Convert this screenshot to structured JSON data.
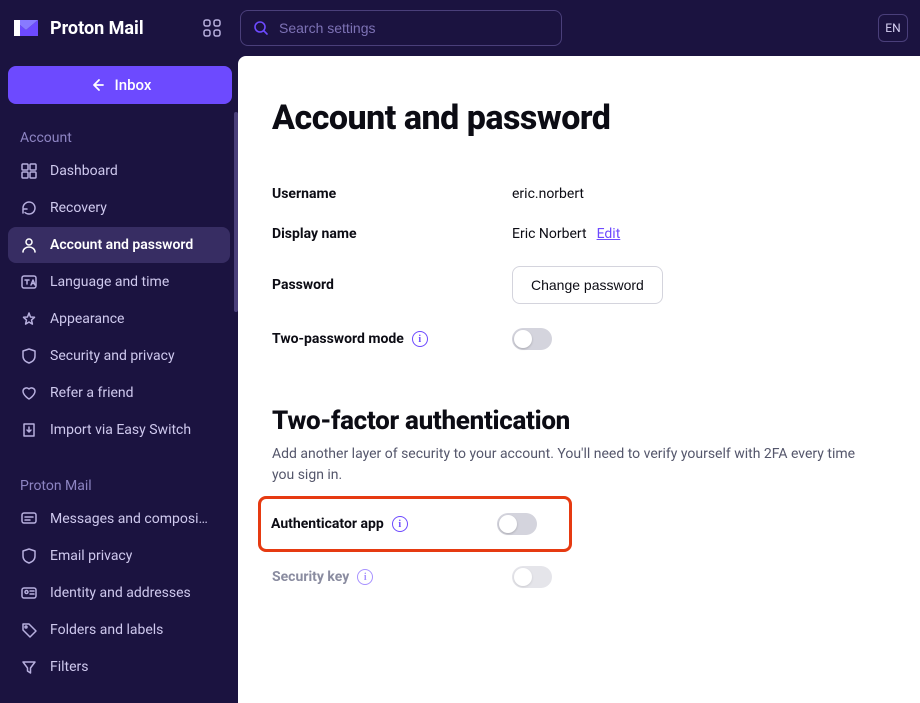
{
  "brand": {
    "name": "Proton Mail"
  },
  "search": {
    "placeholder": "Search settings"
  },
  "lang": "EN",
  "inboxButton": "Inbox",
  "sectionAccount": "Account",
  "sectionProtonMail": "Proton Mail",
  "navAccount": [
    {
      "label": "Dashboard",
      "icon": "dashboard"
    },
    {
      "label": "Recovery",
      "icon": "recovery"
    },
    {
      "label": "Account and password",
      "icon": "user",
      "active": true
    },
    {
      "label": "Language and time",
      "icon": "lang"
    },
    {
      "label": "Appearance",
      "icon": "appearance"
    },
    {
      "label": "Security and privacy",
      "icon": "shield"
    },
    {
      "label": "Refer a friend",
      "icon": "heart"
    },
    {
      "label": "Import via Easy Switch",
      "icon": "import"
    }
  ],
  "navProtonMail": [
    {
      "label": "Messages and composi…",
      "icon": "messages"
    },
    {
      "label": "Email privacy",
      "icon": "shield"
    },
    {
      "label": "Identity and addresses",
      "icon": "identity"
    },
    {
      "label": "Folders and labels",
      "icon": "tag"
    },
    {
      "label": "Filters",
      "icon": "filter"
    }
  ],
  "page": {
    "title": "Account and password",
    "username_label": "Username",
    "username_value": "eric.norbert",
    "displayname_label": "Display name",
    "displayname_value": "Eric Norbert",
    "edit": "Edit",
    "password_label": "Password",
    "change_password": "Change password",
    "two_password_label": "Two-password mode",
    "tfa_title": "Two-factor authentication",
    "tfa_desc": "Add another layer of security to your account. You'll need to verify yourself with 2FA every time you sign in.",
    "auth_app_label": "Authenticator app",
    "security_key_label": "Security key"
  }
}
